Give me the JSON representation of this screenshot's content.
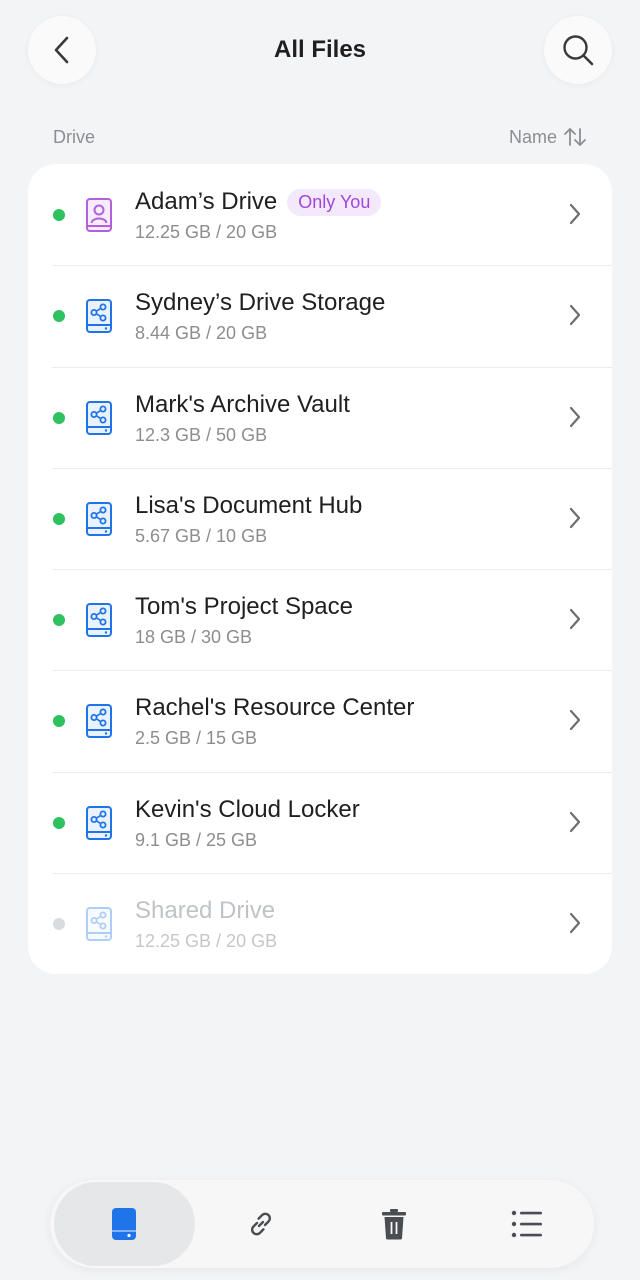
{
  "header": {
    "title": "All Files",
    "back_icon": "chevron-left-icon",
    "search_icon": "search-icon"
  },
  "list_header": {
    "left_label": "Drive",
    "sort_label": "Name",
    "sort_icon": "sort-arrows-icon"
  },
  "drives": [
    {
      "name": "Adam’s Drive",
      "usage": "12.25 GB / 20 GB",
      "badge": "Only You",
      "icon": "personal-drive-icon",
      "status": "online"
    },
    {
      "name": "Sydney’s Drive Storage",
      "usage": "8.44 GB / 20 GB",
      "icon": "shared-drive-icon",
      "status": "online"
    },
    {
      "name": "Mark's Archive Vault",
      "usage": "12.3 GB / 50 GB",
      "icon": "shared-drive-icon",
      "status": "online"
    },
    {
      "name": "Lisa's Document Hub",
      "usage": "5.67 GB / 10 GB",
      "icon": "shared-drive-icon",
      "status": "online"
    },
    {
      "name": "Tom's Project Space",
      "usage": "18 GB / 30 GB",
      "icon": "shared-drive-icon",
      "status": "online"
    },
    {
      "name": "Rachel's Resource Center",
      "usage": "2.5 GB / 15 GB",
      "icon": "shared-drive-icon",
      "status": "online"
    },
    {
      "name": "Kevin's Cloud Locker",
      "usage": "9.1 GB / 25 GB",
      "icon": "shared-drive-icon",
      "status": "online"
    },
    {
      "name": "Shared Drive",
      "usage": "12.25 GB / 20 GB",
      "icon": "shared-drive-icon",
      "status": "offline"
    }
  ],
  "bottom_nav": [
    {
      "icon": "drive-icon",
      "active": true
    },
    {
      "icon": "link-icon",
      "active": false
    },
    {
      "icon": "trash-icon",
      "active": false
    },
    {
      "icon": "list-icon",
      "active": false
    }
  ],
  "colors": {
    "online": "#2fc05f",
    "offline": "#d9dcdf",
    "accent_blue": "#1e74e8",
    "badge_purple": "#a048d8",
    "personal_icon": "#b260dc"
  }
}
